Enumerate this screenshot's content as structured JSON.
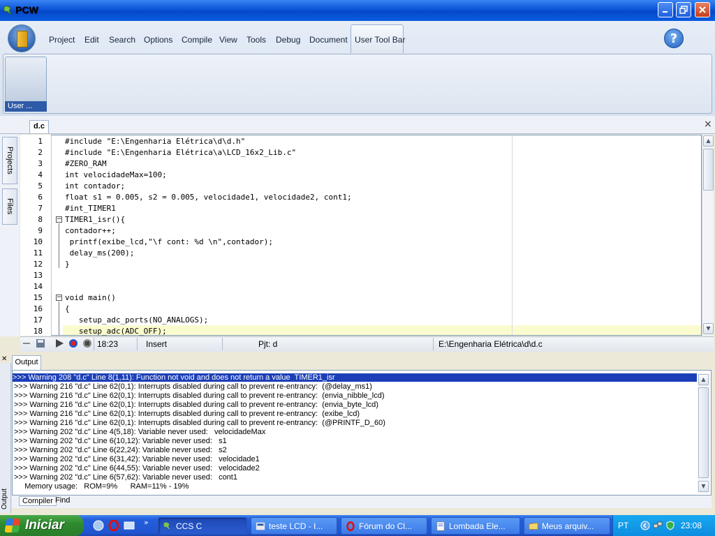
{
  "window": {
    "title": "PCW"
  },
  "menu": {
    "items": [
      "Project",
      "Edit",
      "Search",
      "Options",
      "Compile",
      "View",
      "Tools",
      "Debug",
      "Document",
      "User Tool Bar"
    ]
  },
  "ribbon": {
    "user_group_label": "User ...",
    "help": "?"
  },
  "doc_tabs": {
    "active": "d.c"
  },
  "side_tabs": {
    "projects": "Projects",
    "files": "Files"
  },
  "editor": {
    "line_numbers": [
      "1",
      "2",
      "3",
      "4",
      "5",
      "6",
      "7",
      "8",
      "9",
      "10",
      "11",
      "12",
      "13",
      "14",
      "15",
      "16",
      "17",
      "18"
    ],
    "lines": [
      "#include \"E:\\Engenharia Elétrica\\d\\d.h\"",
      "#include \"E:\\Engenharia Elétrica\\a\\LCD_16x2_Lib.c\"",
      "#ZERO_RAM",
      "int velocidadeMax=100;",
      "int contador;",
      "float s1 = 0.005, s2 = 0.005, velocidade1, velocidade2, cont1;",
      "#int_TIMER1",
      "TIMER1_isr(){",
      "contador++;",
      " printf(exibe_lcd,\"\\f cont: %d \\n\",contador);",
      " delay_ms(200);",
      "}",
      "",
      "",
      "void main()",
      "{",
      "   setup_adc_ports(NO_ANALOGS);",
      "   setup_adc(ADC_OFF);"
    ]
  },
  "status": {
    "position": "18:23",
    "mode": "Insert",
    "project": "Pjt: d",
    "path": "E:\\Engenharia Elétrica\\d\\d.c"
  },
  "output": {
    "tab": "Output",
    "side_label": "Output",
    "lines": [
      ">>> Warning 208 \"d.c\" Line 8(1,11): Function not void and does not return a value  TIMER1_isr",
      ">>> Warning 216 \"d.c\" Line 62(0,1): Interrupts disabled during call to prevent re-entrancy:  (@delay_ms1)",
      ">>> Warning 216 \"d.c\" Line 62(0,1): Interrupts disabled during call to prevent re-entrancy:  (envia_nibble_lcd)",
      ">>> Warning 216 \"d.c\" Line 62(0,1): Interrupts disabled during call to prevent re-entrancy:  (envia_byte_lcd)",
      ">>> Warning 216 \"d.c\" Line 62(0,1): Interrupts disabled during call to prevent re-entrancy:  (exibe_lcd)",
      ">>> Warning 216 \"d.c\" Line 62(0,1): Interrupts disabled during call to prevent re-entrancy:  (@PRINTF_D_60)",
      ">>> Warning 202 \"d.c\" Line 4(5,18): Variable never used:   velocidadeMax",
      ">>> Warning 202 \"d.c\" Line 6(10,12): Variable never used:   s1",
      ">>> Warning 202 \"d.c\" Line 6(22,24): Variable never used:   s2",
      ">>> Warning 202 \"d.c\" Line 6(31,42): Variable never used:   velocidade1",
      ">>> Warning 202 \"d.c\" Line 6(44,55): Variable never used:   velocidade2",
      ">>> Warning 202 \"d.c\" Line 6(57,62): Variable never used:   cont1",
      "     Memory usage:   ROM=9%      RAM=11% - 19%"
    ],
    "bottom_tabs": [
      "Compiler",
      "Find"
    ]
  },
  "taskbar": {
    "start": "Iniciar",
    "tasks": [
      "CCS C",
      "teste LCD - I...",
      "Fórum do Cl...",
      "Lombada Ele...",
      "Meus arquiv..."
    ],
    "language": "PT",
    "clock": "23:08"
  },
  "colors": {
    "accent": "#0a54d8",
    "selection": "#1c3fb8",
    "current_line": "#fbfbd0"
  }
}
